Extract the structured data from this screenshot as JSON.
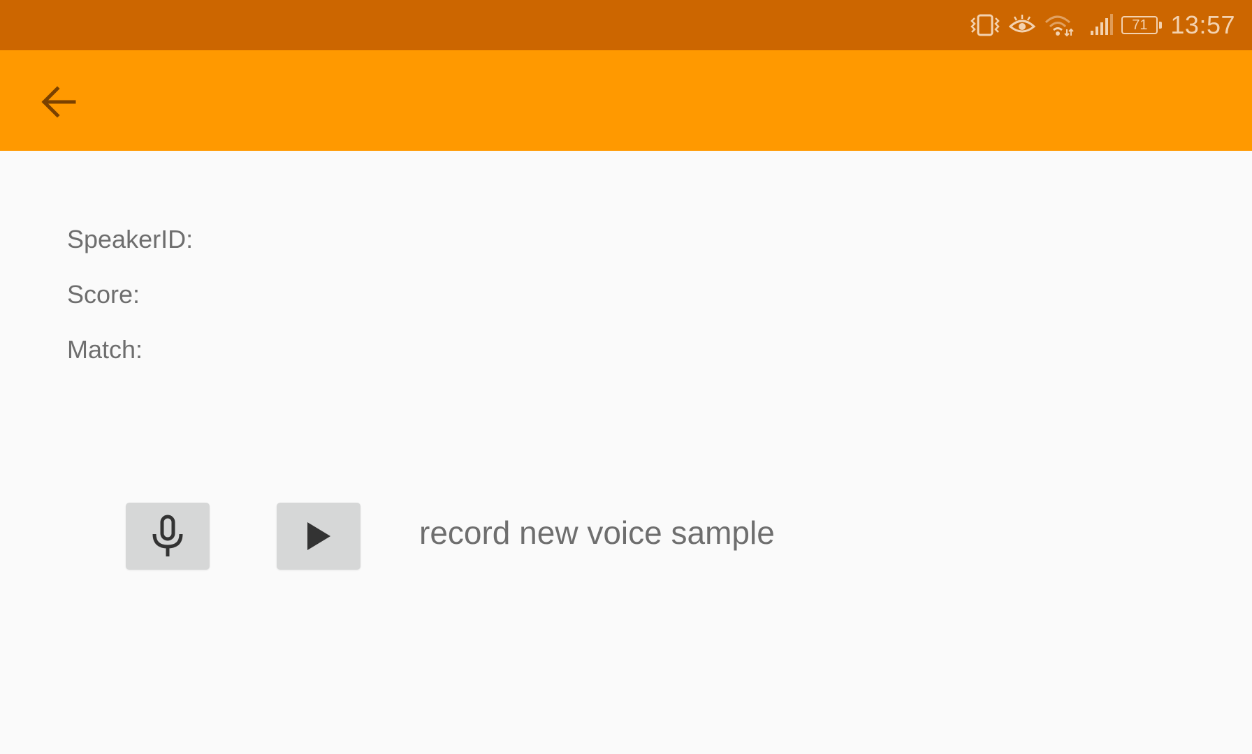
{
  "status_bar": {
    "icons": [
      "vibrate-icon",
      "eye-comfort-icon",
      "wifi-icon",
      "signal-icon"
    ],
    "battery_level": "71",
    "time": "13:57"
  },
  "app_bar": {
    "back_icon": "arrow-back-icon"
  },
  "info": {
    "speaker_id_label": "SpeakerID:",
    "score_label": "Score:",
    "match_label": "Match:"
  },
  "controls": {
    "record_icon": "microphone-icon",
    "play_icon": "play-icon",
    "hint": "record new voice sample"
  },
  "colors": {
    "status_bar": "#CC6600",
    "app_bar": "#FF9900",
    "background": "#FAFAFA",
    "button_bg": "#D6D7D7",
    "text": "#6E6E6E",
    "back_arrow": "#7A4100"
  }
}
